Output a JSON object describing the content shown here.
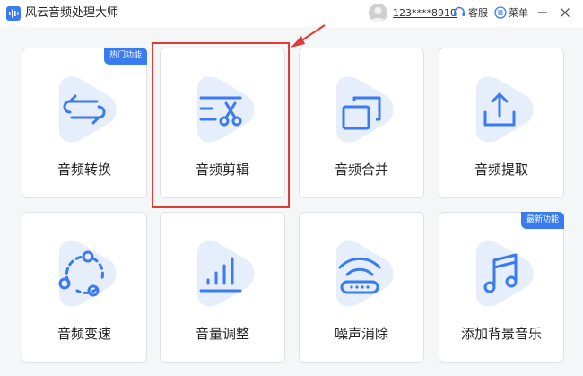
{
  "app": {
    "title": "风云音频处理大师"
  },
  "header": {
    "user_name": "123****8910",
    "support_label": "客服",
    "menu_label": "菜单"
  },
  "colors": {
    "accent": "#3a7bf0",
    "highlight": "#e03a36",
    "blob": "#e6eefc"
  },
  "features": [
    {
      "label": "音频转换",
      "icon": "convert-icon",
      "badge": "热门功能"
    },
    {
      "label": "音频剪辑",
      "icon": "cut-icon",
      "badge": ""
    },
    {
      "label": "音频合并",
      "icon": "merge-icon",
      "badge": ""
    },
    {
      "label": "音频提取",
      "icon": "extract-icon",
      "badge": ""
    },
    {
      "label": "音频变速",
      "icon": "speed-icon",
      "badge": ""
    },
    {
      "label": "音量调整",
      "icon": "volume-icon",
      "badge": ""
    },
    {
      "label": "噪声消除",
      "icon": "noise-icon",
      "badge": ""
    },
    {
      "label": "添加背景音乐",
      "icon": "music-icon",
      "badge": "最新功能"
    }
  ]
}
